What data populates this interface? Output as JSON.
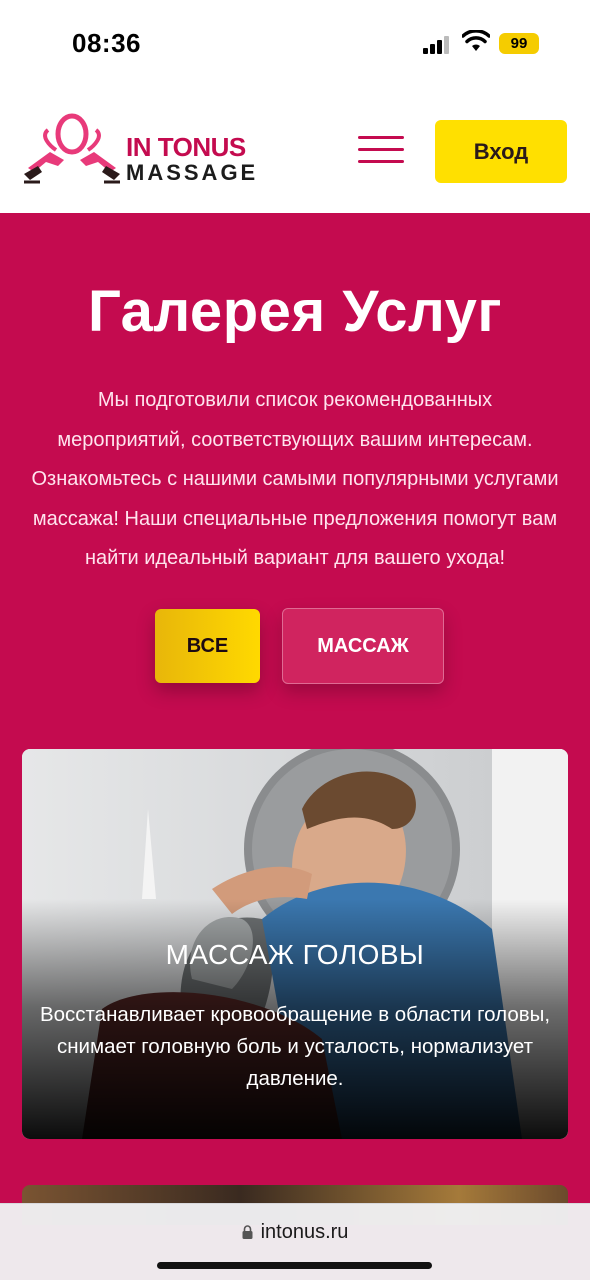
{
  "status_bar": {
    "time": "08:36",
    "battery": "99",
    "signal_icon": "cellular-signal-icon",
    "wifi_icon": "wifi-icon"
  },
  "header": {
    "logo_line1": "IN TONUS",
    "logo_line2": "MASSAGE",
    "menu_icon": "hamburger-menu-icon",
    "login_label": "Вход"
  },
  "hero": {
    "title": "Галерея Услуг",
    "description_lines": [
      "Мы подготовили список рекомендованных",
      "мероприятий, соответствующих вашим интересам.",
      "Ознакомьтесь с нашими самыми популярными услугами",
      "массажа! Наши специальные предложения помогут вам",
      "найти идеальный вариант для вашего ухода!"
    ]
  },
  "filters": [
    {
      "label": "ВСЕ",
      "active": true
    },
    {
      "label": "МАССАЖ",
      "active": false
    }
  ],
  "cards": [
    {
      "title": "МАССАЖ ГОЛОВЫ",
      "description_lines": [
        "Восстанавливает кровообращение в области головы,",
        "снимает головную боль и усталость, нормализует",
        "давление."
      ]
    }
  ],
  "browser": {
    "url": "intonus.ru",
    "lock_icon": "lock-icon"
  },
  "colors": {
    "brand": "#c40b4f",
    "accent": "#ffe000",
    "card_bg": "#d9dbdd"
  }
}
